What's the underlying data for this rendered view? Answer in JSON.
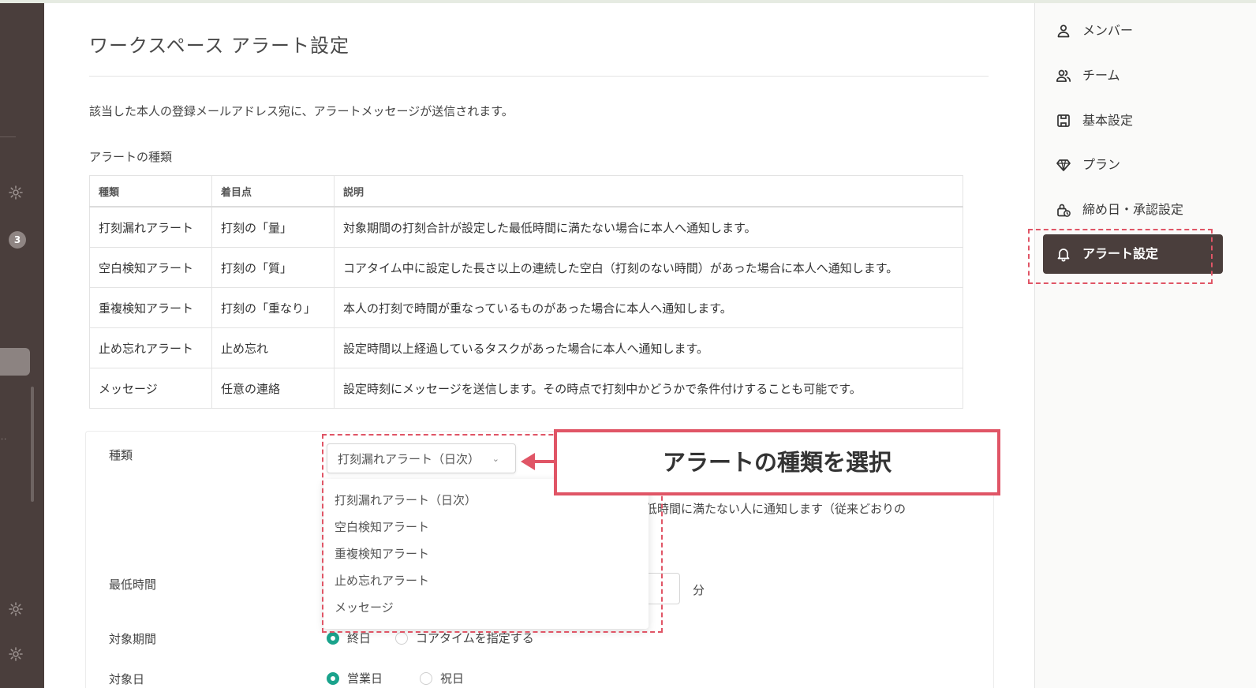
{
  "page": {
    "title": "ワークスペース アラート設定",
    "intro": "該当した本人の登録メールアドレス宛に、アラートメッセージが送信されます。",
    "section_label": "アラートの種類"
  },
  "rail": {
    "badge_count": "3",
    "dots": "··"
  },
  "alert_table": {
    "headers": [
      "種類",
      "着目点",
      "説明"
    ],
    "rows": [
      [
        "打刻漏れアラート",
        "打刻の「量」",
        "対象期間の打刻合計が設定した最低時間に満たない場合に本人へ通知します。"
      ],
      [
        "空白検知アラート",
        "打刻の「質」",
        "コアタイム中に設定した長さ以上の連続した空白（打刻のない時間）があった場合に本人へ通知します。"
      ],
      [
        "重複検知アラート",
        "打刻の「重なり」",
        "本人の打刻で時間が重なっているものがあった場合に本人へ通知します。"
      ],
      [
        "止め忘れアラート",
        "止め忘れ",
        "設定時間以上経過しているタスクがあった場合に本人へ通知します。"
      ],
      [
        "メッセージ",
        "任意の連絡",
        "設定時刻にメッセージを送信します。その時点で打刻中かどうかで条件付けすることも可能です。"
      ]
    ]
  },
  "form": {
    "type_label": "種類",
    "type_selected": "打刻漏れアラート（日次）",
    "description_fragment": "低時間に満たない人に通知します（従来どおりの",
    "min_time_label": "最低時間",
    "min_time_unit": "分",
    "period_label": "対象期間",
    "period_options": [
      "終日",
      "コアタイムを指定する"
    ],
    "target_day_label": "対象日",
    "target_day_options": [
      "営業日",
      "祝日"
    ],
    "dropdown_options": [
      "打刻漏れアラート（日次）",
      "空白検知アラート",
      "重複検知アラート",
      "止め忘れアラート",
      "メッセージ"
    ]
  },
  "callout": {
    "text": "アラートの種類を選択",
    "color": "#e05566"
  },
  "sidebar": {
    "items": [
      {
        "label": "メンバー",
        "icon": "person-icon"
      },
      {
        "label": "チーム",
        "icon": "people-icon"
      },
      {
        "label": "基本設定",
        "icon": "building-icon"
      },
      {
        "label": "プラン",
        "icon": "diamond-icon"
      },
      {
        "label": "締め日・承認設定",
        "icon": "lock-clock-icon"
      }
    ],
    "active": {
      "label": "アラート設定",
      "icon": "bell-icon"
    }
  },
  "colors": {
    "rail": "#4a3e3c",
    "accent": "#1aa38c",
    "highlight": "#e05566"
  }
}
